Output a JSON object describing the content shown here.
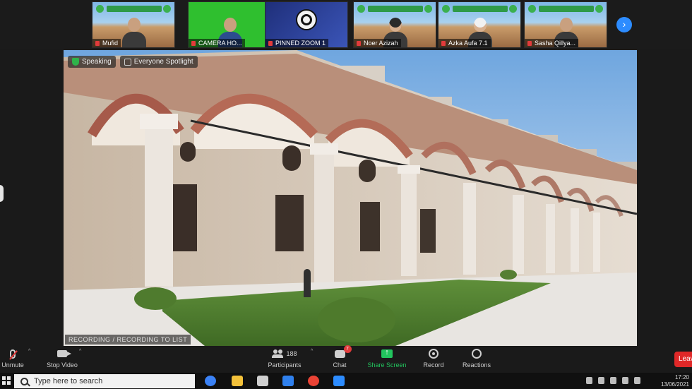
{
  "participants_strip": [
    {
      "name": "Mufid",
      "kind": "person"
    },
    {
      "name": "CAMERA HO...",
      "kind": "green"
    },
    {
      "name": "PINNED ZOOM 1",
      "kind": "zoom"
    },
    {
      "name": "Noer Azizah",
      "kind": "hijab"
    },
    {
      "name": "Azka Aufa 7.1",
      "kind": "white"
    },
    {
      "name": "Sasha Qillya...",
      "kind": "person"
    }
  ],
  "next_page_glyph": "›",
  "main_video": {
    "speaker_chip": "Speaking",
    "spotlight_chip": "Everyone Spotlight",
    "recording_label": "RECORDING / RECORDING TO LIST"
  },
  "toolbar": {
    "unmute": "Unmute",
    "stop_video": "Stop Video",
    "participants": "Participants",
    "participants_count": "188",
    "chat": "Chat",
    "chat_count": "7",
    "share_screen": "Share Screen",
    "record": "Record",
    "reactions": "Reactions",
    "leave": "Leave"
  },
  "taskbar": {
    "search_placeholder": "Type here to search",
    "time": "17:20",
    "date": "13/06/2021"
  },
  "colors": {
    "zoom_blue": "#2d8cff",
    "share_green": "#22c55e",
    "leave_red": "#e02828"
  }
}
